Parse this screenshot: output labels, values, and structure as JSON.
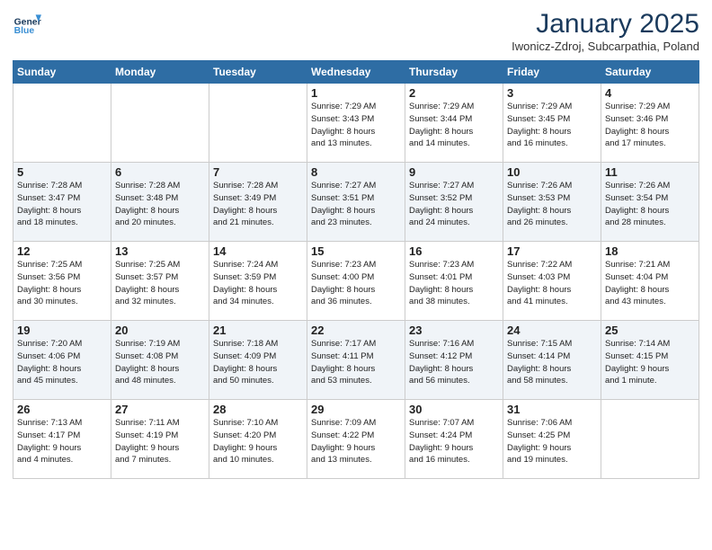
{
  "header": {
    "logo_line1": "General",
    "logo_line2": "Blue",
    "month_title": "January 2025",
    "location": "Iwonicz-Zdroj, Subcarpathia, Poland"
  },
  "weekdays": [
    "Sunday",
    "Monday",
    "Tuesday",
    "Wednesday",
    "Thursday",
    "Friday",
    "Saturday"
  ],
  "weeks": [
    [
      {
        "day": "",
        "info": ""
      },
      {
        "day": "",
        "info": ""
      },
      {
        "day": "",
        "info": ""
      },
      {
        "day": "1",
        "info": "Sunrise: 7:29 AM\nSunset: 3:43 PM\nDaylight: 8 hours\nand 13 minutes."
      },
      {
        "day": "2",
        "info": "Sunrise: 7:29 AM\nSunset: 3:44 PM\nDaylight: 8 hours\nand 14 minutes."
      },
      {
        "day": "3",
        "info": "Sunrise: 7:29 AM\nSunset: 3:45 PM\nDaylight: 8 hours\nand 16 minutes."
      },
      {
        "day": "4",
        "info": "Sunrise: 7:29 AM\nSunset: 3:46 PM\nDaylight: 8 hours\nand 17 minutes."
      }
    ],
    [
      {
        "day": "5",
        "info": "Sunrise: 7:28 AM\nSunset: 3:47 PM\nDaylight: 8 hours\nand 18 minutes."
      },
      {
        "day": "6",
        "info": "Sunrise: 7:28 AM\nSunset: 3:48 PM\nDaylight: 8 hours\nand 20 minutes."
      },
      {
        "day": "7",
        "info": "Sunrise: 7:28 AM\nSunset: 3:49 PM\nDaylight: 8 hours\nand 21 minutes."
      },
      {
        "day": "8",
        "info": "Sunrise: 7:27 AM\nSunset: 3:51 PM\nDaylight: 8 hours\nand 23 minutes."
      },
      {
        "day": "9",
        "info": "Sunrise: 7:27 AM\nSunset: 3:52 PM\nDaylight: 8 hours\nand 24 minutes."
      },
      {
        "day": "10",
        "info": "Sunrise: 7:26 AM\nSunset: 3:53 PM\nDaylight: 8 hours\nand 26 minutes."
      },
      {
        "day": "11",
        "info": "Sunrise: 7:26 AM\nSunset: 3:54 PM\nDaylight: 8 hours\nand 28 minutes."
      }
    ],
    [
      {
        "day": "12",
        "info": "Sunrise: 7:25 AM\nSunset: 3:56 PM\nDaylight: 8 hours\nand 30 minutes."
      },
      {
        "day": "13",
        "info": "Sunrise: 7:25 AM\nSunset: 3:57 PM\nDaylight: 8 hours\nand 32 minutes."
      },
      {
        "day": "14",
        "info": "Sunrise: 7:24 AM\nSunset: 3:59 PM\nDaylight: 8 hours\nand 34 minutes."
      },
      {
        "day": "15",
        "info": "Sunrise: 7:23 AM\nSunset: 4:00 PM\nDaylight: 8 hours\nand 36 minutes."
      },
      {
        "day": "16",
        "info": "Sunrise: 7:23 AM\nSunset: 4:01 PM\nDaylight: 8 hours\nand 38 minutes."
      },
      {
        "day": "17",
        "info": "Sunrise: 7:22 AM\nSunset: 4:03 PM\nDaylight: 8 hours\nand 41 minutes."
      },
      {
        "day": "18",
        "info": "Sunrise: 7:21 AM\nSunset: 4:04 PM\nDaylight: 8 hours\nand 43 minutes."
      }
    ],
    [
      {
        "day": "19",
        "info": "Sunrise: 7:20 AM\nSunset: 4:06 PM\nDaylight: 8 hours\nand 45 minutes."
      },
      {
        "day": "20",
        "info": "Sunrise: 7:19 AM\nSunset: 4:08 PM\nDaylight: 8 hours\nand 48 minutes."
      },
      {
        "day": "21",
        "info": "Sunrise: 7:18 AM\nSunset: 4:09 PM\nDaylight: 8 hours\nand 50 minutes."
      },
      {
        "day": "22",
        "info": "Sunrise: 7:17 AM\nSunset: 4:11 PM\nDaylight: 8 hours\nand 53 minutes."
      },
      {
        "day": "23",
        "info": "Sunrise: 7:16 AM\nSunset: 4:12 PM\nDaylight: 8 hours\nand 56 minutes."
      },
      {
        "day": "24",
        "info": "Sunrise: 7:15 AM\nSunset: 4:14 PM\nDaylight: 8 hours\nand 58 minutes."
      },
      {
        "day": "25",
        "info": "Sunrise: 7:14 AM\nSunset: 4:15 PM\nDaylight: 9 hours\nand 1 minute."
      }
    ],
    [
      {
        "day": "26",
        "info": "Sunrise: 7:13 AM\nSunset: 4:17 PM\nDaylight: 9 hours\nand 4 minutes."
      },
      {
        "day": "27",
        "info": "Sunrise: 7:11 AM\nSunset: 4:19 PM\nDaylight: 9 hours\nand 7 minutes."
      },
      {
        "day": "28",
        "info": "Sunrise: 7:10 AM\nSunset: 4:20 PM\nDaylight: 9 hours\nand 10 minutes."
      },
      {
        "day": "29",
        "info": "Sunrise: 7:09 AM\nSunset: 4:22 PM\nDaylight: 9 hours\nand 13 minutes."
      },
      {
        "day": "30",
        "info": "Sunrise: 7:07 AM\nSunset: 4:24 PM\nDaylight: 9 hours\nand 16 minutes."
      },
      {
        "day": "31",
        "info": "Sunrise: 7:06 AM\nSunset: 4:25 PM\nDaylight: 9 hours\nand 19 minutes."
      },
      {
        "day": "",
        "info": ""
      }
    ]
  ]
}
